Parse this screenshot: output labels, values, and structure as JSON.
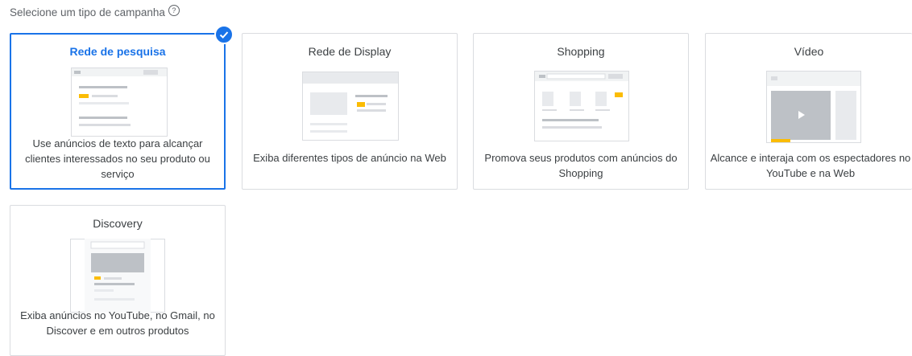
{
  "header": {
    "title": "Selecione um tipo de campanha",
    "help_icon": "help-circle-icon"
  },
  "campaign_types": [
    {
      "title": "Rede de pesquisa",
      "description": "Use anúncios de texto para alcançar clientes interessados no seu produto ou serviço",
      "selected": true
    },
    {
      "title": "Rede de Display",
      "description": "Exiba diferentes tipos de anúncio na Web",
      "selected": false
    },
    {
      "title": "Shopping",
      "description": "Promova seus produtos com anúncios do Shopping",
      "selected": false
    },
    {
      "title": "Vídeo",
      "description": "Alcance e interaja com os espectadores no YouTube e na Web",
      "selected": false
    },
    {
      "title": "Discovery",
      "description": "Exiba anúncios no YouTube, no Gmail, no Discover e em outros produtos",
      "selected": false
    }
  ],
  "colors": {
    "accent": "#1a73e8",
    "highlight": "#fbbc04",
    "border": "#dadce0",
    "placeholder": "#e8eaed"
  }
}
